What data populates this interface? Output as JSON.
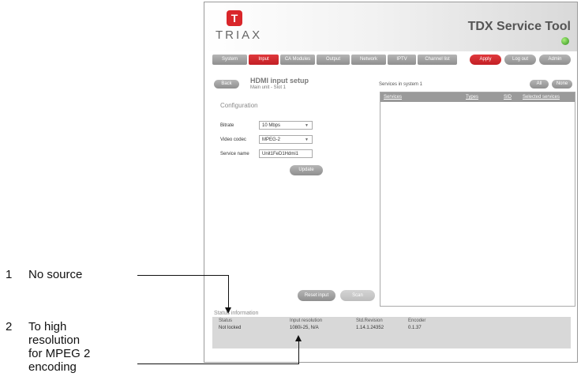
{
  "header": {
    "logo_mark": "T",
    "logo_text": "TRIAX",
    "app_title": "TDX Service Tool"
  },
  "nav": {
    "tabs": [
      "System",
      "Input",
      "CA Modules",
      "Output",
      "Network",
      "IPTV",
      "Channel list"
    ],
    "active": "Input",
    "right_buttons": [
      "Apply",
      "Log out",
      "Admin"
    ]
  },
  "page": {
    "back_label": "Back",
    "title": "HDMI input setup",
    "subtitle": "Main unit - Slot 1",
    "section_title": "Configuration"
  },
  "form": {
    "bitrate_label": "Bitrate",
    "bitrate_value": "10 Mbps",
    "codec_label": "Video codec",
    "codec_value": "MPEG-2",
    "service_label": "Service name",
    "service_value": "Unit1FeD1Hdmi1",
    "update_label": "Update"
  },
  "services": {
    "label": "Services in system 1",
    "buttons": [
      "All",
      "None"
    ],
    "columns": [
      "Services",
      "Types",
      "SID",
      "Selected services"
    ]
  },
  "actions": {
    "reset_label": "Reset input",
    "disabled_label": "Scan"
  },
  "status": {
    "title": "Status information",
    "headers": [
      "Status",
      "Input resolution",
      "Std.Revision",
      "Encoder"
    ],
    "values": [
      "Not locked",
      "1080i-25, N/A",
      "1.14.1.24352",
      "0.1.37"
    ]
  },
  "annotations": {
    "a1_num": "1",
    "a1_text": "No source",
    "a2_num": "2",
    "a2_lines": [
      "To high",
      "resolution",
      "for MPEG 2",
      "encoding"
    ]
  },
  "colors": {
    "accent": "#d9262a",
    "button_grey": "#9a9a9a",
    "status_bg": "#d8d8d8",
    "led": "#2f8d1b"
  }
}
